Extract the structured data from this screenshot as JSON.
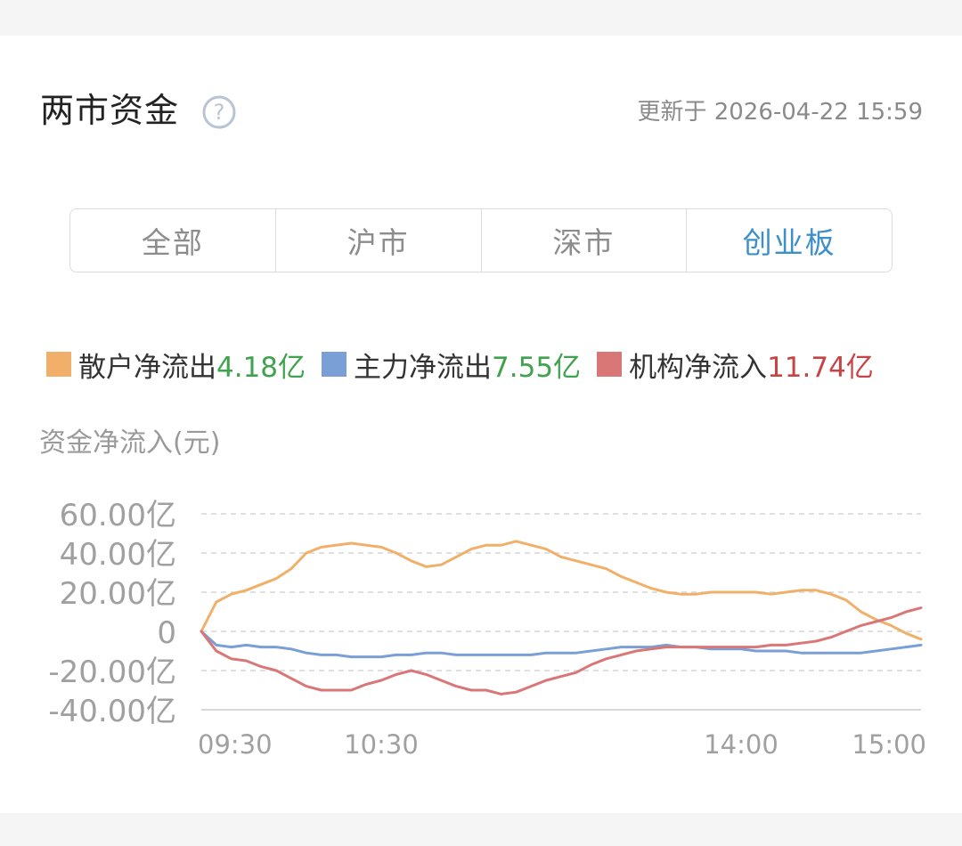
{
  "header": {
    "title": "两市资金",
    "update_text": "更新于 2026-04-22 15:59"
  },
  "tabs": [
    {
      "label": "全部",
      "active": false
    },
    {
      "label": "沪市",
      "active": false
    },
    {
      "label": "深市",
      "active": false
    },
    {
      "label": "创业板",
      "active": true
    }
  ],
  "legend": [
    {
      "label": "散户净流出",
      "value": "4.18亿",
      "swatch_color": "#f0b06a",
      "value_color": "#3fa34d"
    },
    {
      "label": "主力净流出",
      "value": "7.55亿",
      "swatch_color": "#7a9fd6",
      "value_color": "#3fa34d"
    },
    {
      "label": "机构净流入",
      "value": "11.74亿",
      "swatch_color": "#d97777",
      "value_color": "#c84444"
    }
  ],
  "colors": {
    "accent": "#3d8fc7",
    "outflow_green": "#3fa34d",
    "inflow_red": "#c84444"
  },
  "chart_data": {
    "type": "line",
    "ylabel": "资金净流入(元)",
    "ylim": [
      -40,
      60
    ],
    "y_ticks": [
      "60.00亿",
      "40.00亿",
      "20.00亿",
      "0",
      "-20.00亿",
      "-40.00亿"
    ],
    "y_tick_values": [
      60,
      40,
      20,
      0,
      -20,
      -40
    ],
    "x_ticks": [
      "09:30",
      "10:30",
      "14:00",
      "15:00"
    ],
    "x_tick_indices": [
      0,
      12,
      36,
      48
    ],
    "x_count": 49,
    "grid": true,
    "series": [
      {
        "name": "散户净流出",
        "color": "#f0b06a",
        "values": [
          0,
          15,
          19,
          21,
          24,
          27,
          32,
          40,
          43,
          44,
          45,
          44,
          43,
          40,
          36,
          33,
          34,
          38,
          42,
          44,
          44,
          46,
          44,
          42,
          38,
          36,
          34,
          32,
          28,
          25,
          22,
          20,
          19,
          19,
          20,
          20,
          20,
          20,
          19,
          20,
          21,
          21,
          19,
          16,
          10,
          6,
          3,
          -1,
          -4
        ]
      },
      {
        "name": "主力净流出",
        "color": "#7a9fd6",
        "values": [
          0,
          -7,
          -8,
          -7,
          -8,
          -8,
          -9,
          -11,
          -12,
          -12,
          -13,
          -13,
          -13,
          -12,
          -12,
          -11,
          -11,
          -12,
          -12,
          -12,
          -12,
          -12,
          -12,
          -11,
          -11,
          -11,
          -10,
          -9,
          -8,
          -8,
          -8,
          -7,
          -8,
          -8,
          -9,
          -9,
          -9,
          -10,
          -10,
          -10,
          -11,
          -11,
          -11,
          -11,
          -11,
          -10,
          -9,
          -8,
          -7
        ]
      },
      {
        "name": "机构净流入",
        "color": "#d97777",
        "values": [
          0,
          -10,
          -14,
          -15,
          -18,
          -20,
          -24,
          -28,
          -30,
          -30,
          -30,
          -27,
          -25,
          -22,
          -20,
          -22,
          -25,
          -28,
          -30,
          -30,
          -32,
          -31,
          -28,
          -25,
          -23,
          -21,
          -17,
          -14,
          -12,
          -10,
          -9,
          -8,
          -8,
          -8,
          -8,
          -8,
          -8,
          -8,
          -7,
          -7,
          -6,
          -5,
          -3,
          0,
          3,
          5,
          7,
          10,
          12
        ]
      }
    ]
  }
}
